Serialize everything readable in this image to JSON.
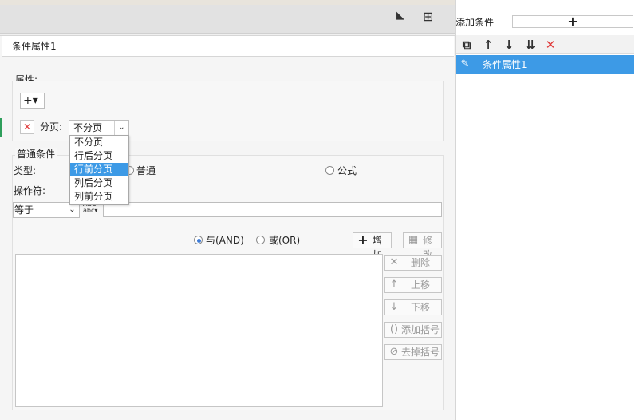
{
  "right_panel": {
    "add_condition_label": "添加条件",
    "add_button_glyph": "+",
    "tools": [
      {
        "name": "copy-icon",
        "glyph": "⧉"
      },
      {
        "name": "move-up-icon",
        "glyph": "↑"
      },
      {
        "name": "move-down-icon",
        "glyph": "↓"
      },
      {
        "name": "move-bottom-icon",
        "glyph": "⇊"
      },
      {
        "name": "delete-icon",
        "glyph": "✕"
      }
    ],
    "items": [
      {
        "label": "条件属性1",
        "selected": true
      }
    ]
  },
  "main": {
    "tab_title": "条件属性1",
    "attributes": {
      "section_label": "属性:",
      "add_glyph": "+▾",
      "paging_label": "分页:",
      "paging_value": "不分页",
      "paging_options": [
        "不分页",
        "行后分页",
        "行前分页",
        "列后分页",
        "列前分页"
      ],
      "paging_highlighted": "行前分页"
    },
    "common_condition": {
      "legend": "普通条件",
      "type_label": "类型:",
      "type_options": [
        {
          "label": "普通",
          "checked": false
        },
        {
          "label": "公式",
          "checked": false
        }
      ],
      "operator_label": "操作符:",
      "operator_value": "等于",
      "value_text": ""
    },
    "logic": {
      "and_label": "与(AND)",
      "or_label": "或(OR)",
      "and_checked": true
    },
    "buttons": {
      "add": "增加",
      "modify": "修改",
      "delete": "删除",
      "move_up": "上移",
      "move_down": "下移",
      "add_bracket": "添加括号",
      "remove_bracket": "去掉括号"
    }
  },
  "colors": {
    "accent": "#3d9ae6",
    "delete_red": "#e03b3b"
  }
}
